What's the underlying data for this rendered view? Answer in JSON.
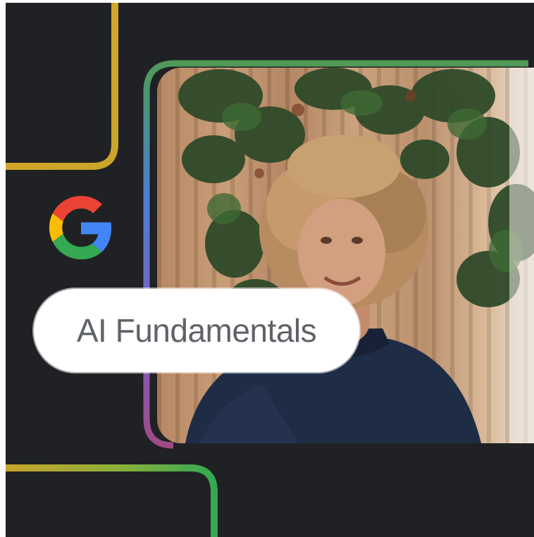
{
  "badge": {
    "label": "AI Fundamentals"
  },
  "icons": {
    "logo": "google-g-icon",
    "photo": "person-photo"
  },
  "colors": {
    "background": "#202124",
    "google_blue": "#4285F4",
    "google_red": "#EA4335",
    "google_yellow": "#FBBC04",
    "google_green": "#34A853",
    "pill_text": "#5f6368"
  }
}
